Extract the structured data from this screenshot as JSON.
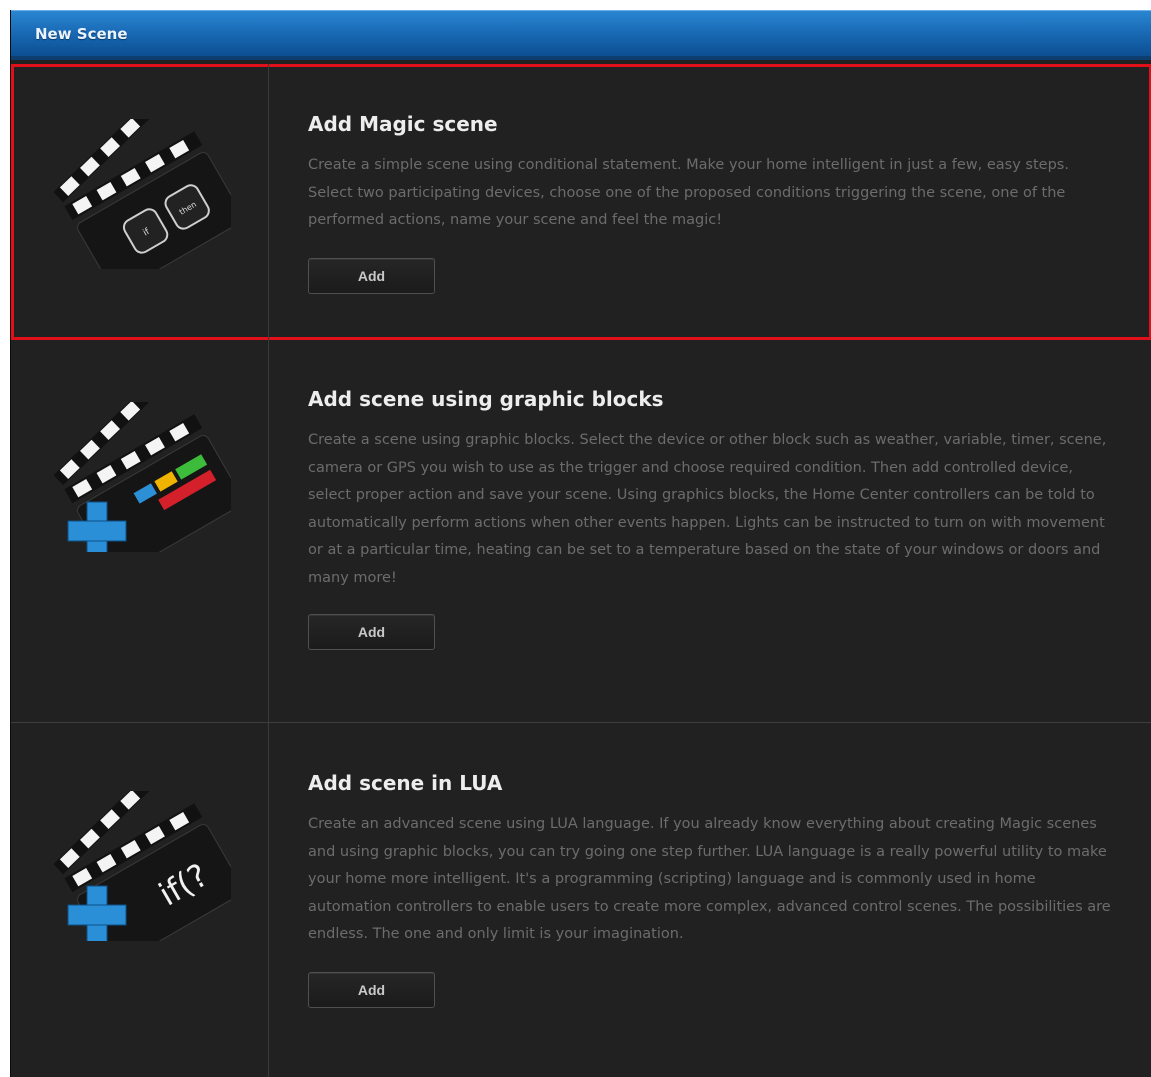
{
  "window": {
    "title": "New Scene"
  },
  "scenes": [
    {
      "title": "Add Magic scene",
      "description": "Create a simple scene using conditional statement. Make your home intelligent in just a few, easy steps. Select two participating devices, choose one of the proposed conditions triggering the scene, one of the performed actions, name your scene and feel the magic!",
      "button_label": "Add",
      "icon": "clapperboard-if-then-icon",
      "icon_text": [
        "if",
        "then"
      ]
    },
    {
      "title": "Add scene using graphic blocks",
      "description": "Create a scene using graphic blocks. Select the device or other block such as weather, variable, timer, scene, camera or GPS you wish to use as the trigger and choose required condition. Then add controlled device, select proper action and save your scene. Using graphics blocks, the Home Center controllers can be told to automatically perform actions when other events happen. Lights can be instructed to turn on with movement or at a particular time, heating can be set to a temperature based on the state of your windows or doors and many more!",
      "button_label": "Add",
      "icon": "clapperboard-blocks-plus-icon"
    },
    {
      "title": "Add scene in LUA",
      "description": "Create an advanced scene using LUA language. If you already know everything about creating Magic scenes and using graphic blocks, you can try going one step further. LUA language is a really powerful utility to make your home more intelligent. It's a programming (scripting) language and is commonly used in home automation controllers to enable users to create more complex, advanced control scenes. The possibilities are endless. The one and only limit is your imagination.",
      "button_label": "Add",
      "icon": "clapperboard-lua-plus-icon",
      "icon_text": "if(?"
    }
  ],
  "colors": {
    "titlebar": "#1766b0",
    "panel": "#212121",
    "highlight": "#e0101a",
    "plus": "#2b8fd8"
  }
}
